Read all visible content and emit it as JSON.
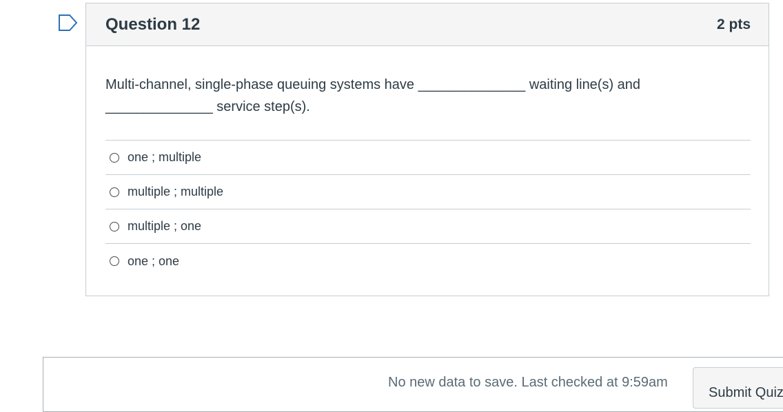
{
  "question": {
    "title": "Question 12",
    "points": "2 pts",
    "text": "Multi-channel, single-phase queuing systems have ______________ waiting line(s) and ______________ service step(s).",
    "answers": [
      {
        "label": "one ; multiple"
      },
      {
        "label": "multiple ; multiple"
      },
      {
        "label": "multiple ; one"
      },
      {
        "label": "one ; one"
      }
    ]
  },
  "footer": {
    "status": "No new data to save. Last checked at 9:59am",
    "submit_label": "Submit Quiz"
  },
  "colors": {
    "text": "#2d3b45",
    "border": "#c7cdd1",
    "header_bg": "#f5f5f5",
    "flag": "#2d6fb8"
  },
  "icons": {
    "flag": "flag-question-icon"
  }
}
